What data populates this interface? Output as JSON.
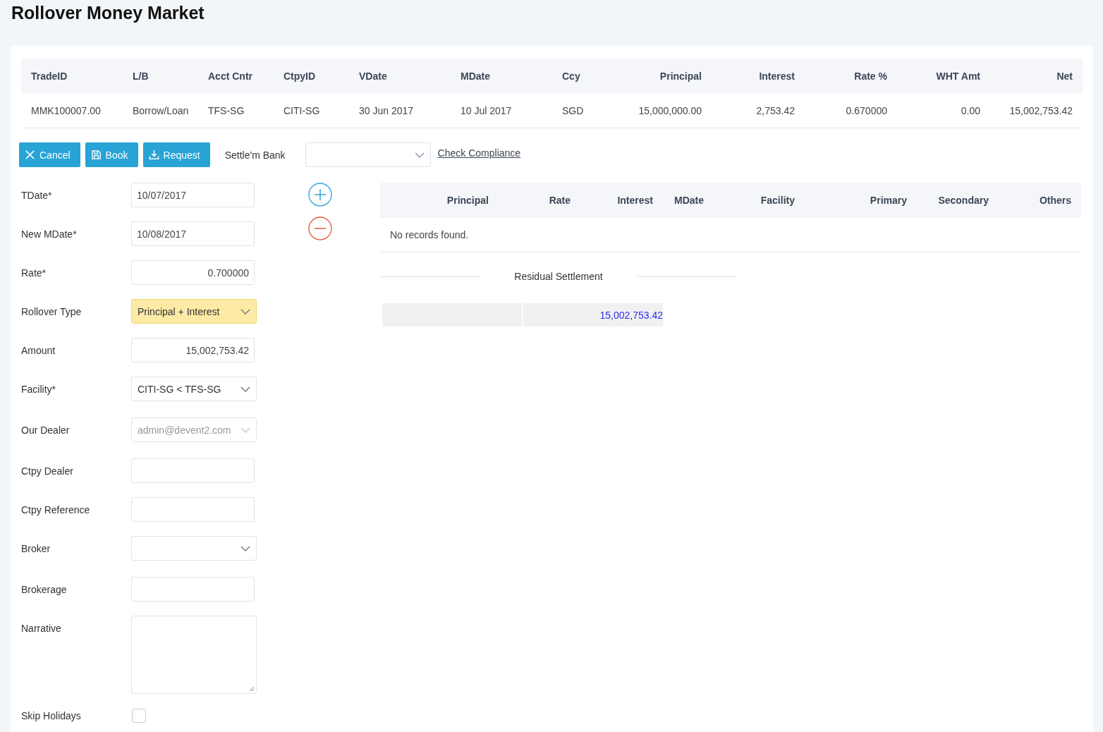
{
  "title": "Rollover Money Market",
  "trade_table": {
    "columns": [
      "TradeID",
      "L/B",
      "Acct Cntr",
      "CtpyID",
      "VDate",
      "MDate",
      "Ccy",
      "Principal",
      "Interest",
      "Rate %",
      "WHT Amt",
      "Net"
    ],
    "rows": [
      [
        "MMK100007.00",
        "Borrow/Loan",
        "TFS-SG",
        "CITI-SG",
        "30 Jun 2017",
        "10 Jul 2017",
        "SGD",
        "15,000,000.00",
        "2,753.42",
        "0.670000",
        "0.00",
        "15,002,753.42"
      ]
    ]
  },
  "toolbar": {
    "buttons": [
      {
        "label": "Cancel",
        "kind": "cancel"
      },
      {
        "label": "Book",
        "kind": "save"
      },
      {
        "label": "Request",
        "kind": "download"
      }
    ],
    "settle_bank": {
      "label": "Settle'm Bank"
    },
    "link": "Check Compliance"
  },
  "form": [
    {
      "label": "TDate*",
      "kind": "text",
      "value": "10/07/2017",
      "right_aligned": false
    },
    {
      "label": "New MDate*",
      "kind": "text",
      "value": "10/08/2017",
      "right_aligned": false
    },
    {
      "label": "Rate*",
      "kind": "text",
      "value": "0.700000",
      "right_aligned": true
    },
    {
      "label": "Rollover Type",
      "kind": "select",
      "value": "Principal + Interest",
      "highlighted": true,
      "disabled": false
    },
    {
      "label": "Amount",
      "kind": "text",
      "value": "15,002,753.42",
      "right_aligned": true
    },
    {
      "label": "Facility*",
      "kind": "select",
      "value": "CITI-SG < TFS-SG",
      "highlighted": false,
      "disabled": false
    },
    {
      "label": "Our Dealer",
      "kind": "select",
      "value": "admin@devent2.com",
      "highlighted": false,
      "disabled": true
    },
    {
      "label": "Ctpy Dealer",
      "kind": "text"
    },
    {
      "label": "Ctpy Reference",
      "kind": "text"
    },
    {
      "label": "Broker",
      "kind": "select",
      "highlighted": false,
      "disabled": false
    },
    {
      "label": "Brokerage",
      "kind": "text"
    },
    {
      "label": "Narrative",
      "kind": "textarea"
    },
    {
      "label": "Skip Holidays",
      "kind": "checkbox",
      "checked": false
    }
  ],
  "settlement_table": {
    "columns": [
      "Principal",
      "Rate",
      "Interest",
      "MDate",
      "Facility",
      "Primary",
      "Secondary",
      "Others"
    ],
    "empty_message": "No records found."
  },
  "residual": {
    "title": "Residual Settlement",
    "amount": "15,002,753.42"
  }
}
